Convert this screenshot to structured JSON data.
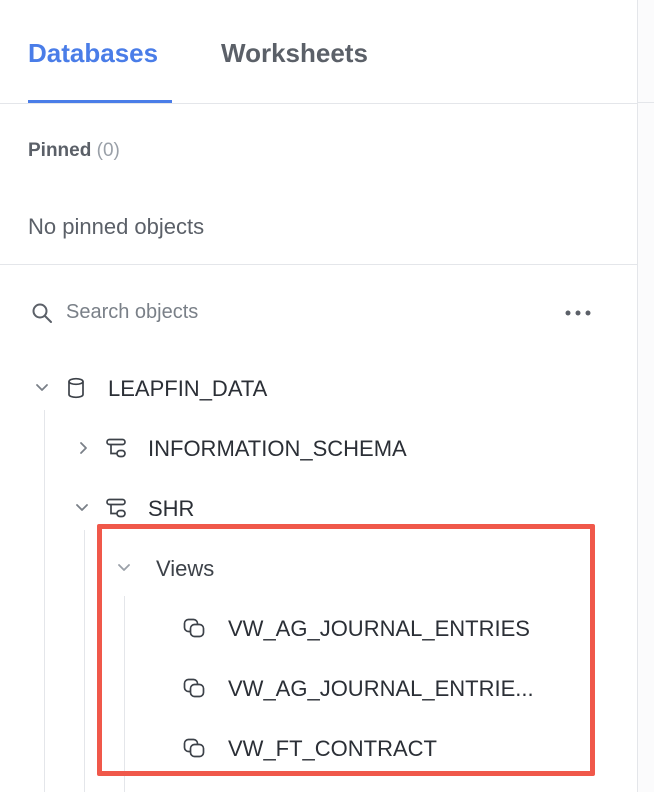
{
  "tabs": [
    {
      "label": "Databases",
      "active": true
    },
    {
      "label": "Worksheets",
      "active": false
    }
  ],
  "pinned": {
    "header": "Pinned",
    "count": "(0)",
    "empty_text": "No pinned objects"
  },
  "search": {
    "placeholder": "Search objects",
    "icon": "search-icon",
    "more_icon": "more-horizontal-icon"
  },
  "tree": {
    "database": {
      "label": "LEAPFIN_DATA",
      "expanded": true,
      "icon": "database-icon"
    },
    "schemas": [
      {
        "label": "INFORMATION_SCHEMA",
        "expanded": false,
        "icon": "schema-icon"
      },
      {
        "label": "SHR",
        "expanded": true,
        "icon": "schema-icon"
      }
    ],
    "views_group": {
      "label": "Views",
      "expanded": true
    },
    "views": [
      {
        "label": "VW_AG_JOURNAL_ENTRIES",
        "icon": "view-icon"
      },
      {
        "label": "VW_AG_JOURNAL_ENTRIE...",
        "icon": "view-icon"
      },
      {
        "label": "VW_FT_CONTRACT",
        "icon": "view-icon"
      }
    ]
  },
  "colors": {
    "accent": "#4a7de8",
    "highlight": "#f0584a",
    "text": "#2b2f36",
    "muted": "#5b6068"
  }
}
